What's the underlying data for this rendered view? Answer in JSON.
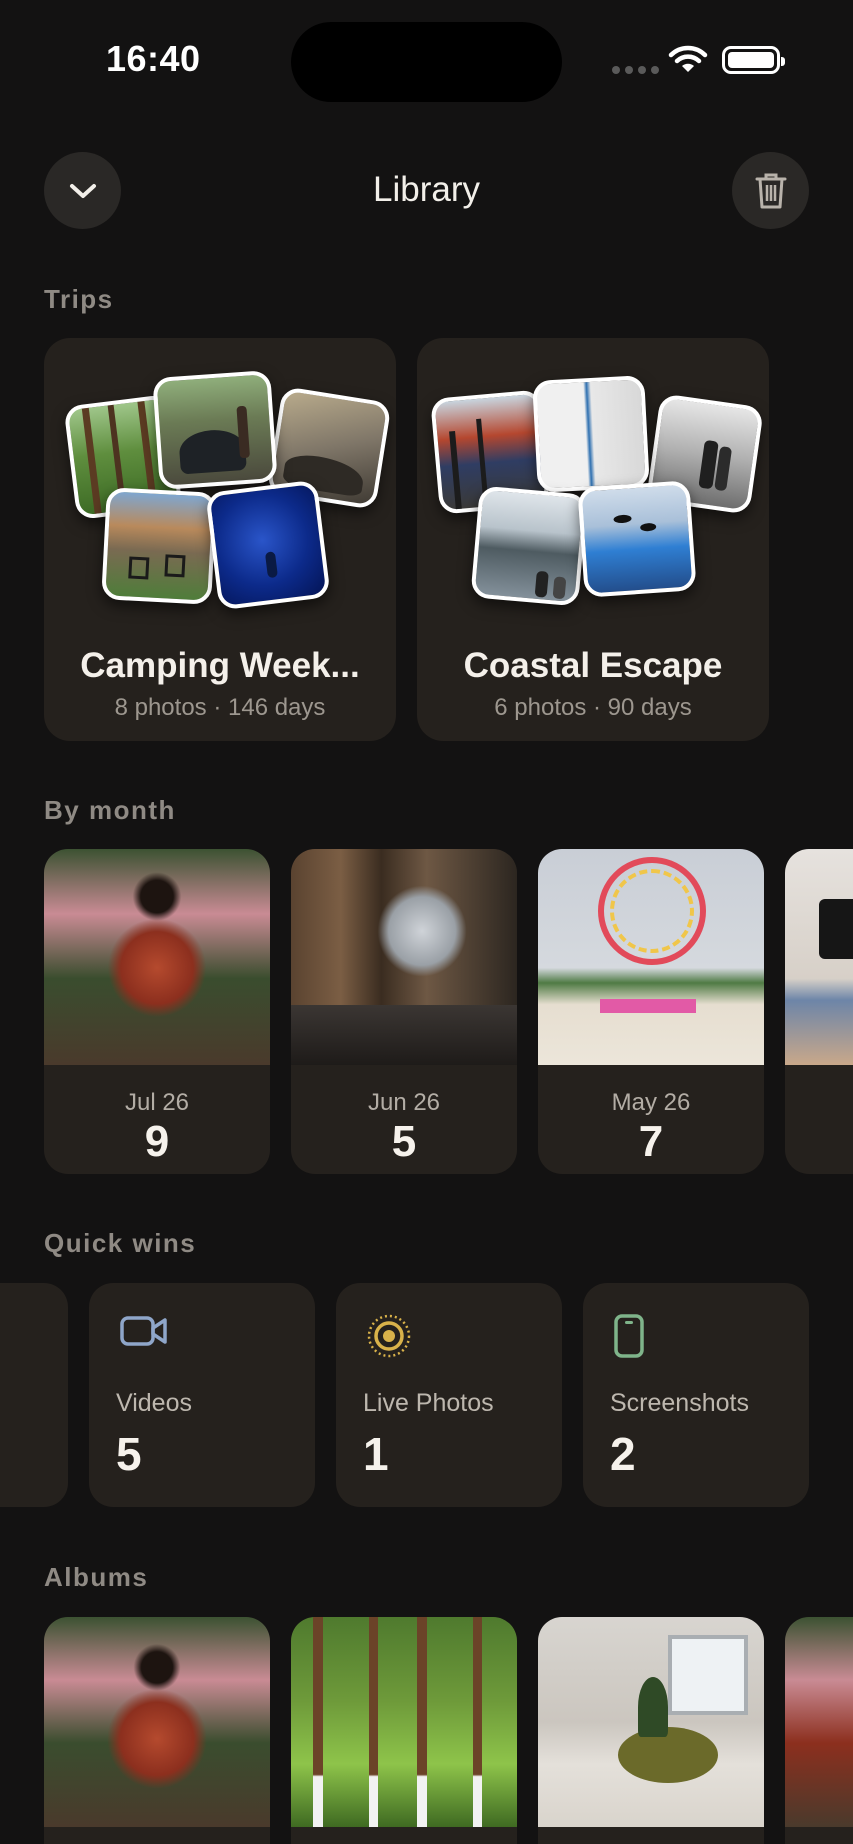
{
  "status": {
    "time": "16:40"
  },
  "header": {
    "title": "Library",
    "collapse_icon": "chevron-down-icon",
    "delete_icon": "trash-icon"
  },
  "sections": {
    "trips": "Trips",
    "by_month": "By month",
    "quick_wins": "Quick wins",
    "albums": "Albums"
  },
  "trips": [
    {
      "title": "Camping Week...",
      "subtitle": "8 photos · 146 days"
    },
    {
      "title": "Coastal Escape",
      "subtitle": "6 photos · 90 days"
    }
  ],
  "months": [
    {
      "label": "Jul 26",
      "count": "9"
    },
    {
      "label": "Jun 26",
      "count": "5"
    },
    {
      "label": "May 26",
      "count": "7"
    }
  ],
  "quick_wins": [
    {
      "label": "Videos",
      "count": "5",
      "icon": "video-camera-icon",
      "color": "#8fa6c9"
    },
    {
      "label": "Live Photos",
      "count": "1",
      "icon": "live-photo-icon",
      "color": "#d9b24a"
    },
    {
      "label": "Screenshots",
      "count": "2",
      "icon": "phone-icon",
      "color": "#7fb48a"
    }
  ],
  "colors": {
    "background": "#131212",
    "card": "#25211d",
    "section_title": "#8f8a84"
  }
}
